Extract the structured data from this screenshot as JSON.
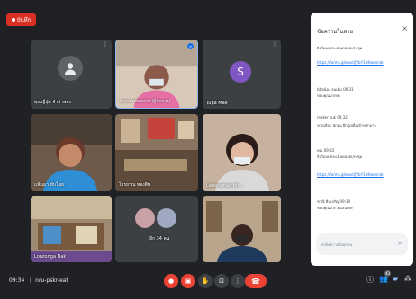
{
  "recording": {
    "label": "บันทึก"
  },
  "participants": [
    {
      "name": "คุณญี่ปุ่ม จำปาพอง",
      "avatar": ""
    },
    {
      "name": "มุกพร เสนาสาย (ผู้จัดการ)",
      "avatar": ""
    },
    {
      "name": "Tupa Mae",
      "avatar": "S"
    },
    {
      "name": "แพ้นมา ทับไชย",
      "avatar": ""
    },
    {
      "name": "ไวรยาณ ทองสิน",
      "avatar": ""
    },
    {
      "name": "Ladaramaa phi...",
      "avatar": ""
    },
    {
      "name": "Lonzonga Nak",
      "avatar": ""
    },
    {
      "name": "อีก 34 คน",
      "avatar": ""
    },
    {
      "name": "",
      "avatar": ""
    }
  ],
  "chat": {
    "title": "ข้อความในสาย",
    "close_icon": "close-icon",
    "messages": [
      {
        "text": "ลิงก์แบบประเมินหน่วยประชุม"
      },
      {
        "link": "https://forms.gle/xxUJVbY3NHomnnb"
      },
      {
        "text": "นิสิตน้อง จนเดิม 09:31"
      },
      {
        "text": "ขอบคุณมากค่ะ"
      },
      {
        "text": "rooker suk 09:32"
      },
      {
        "text": "ขาดเลือก นักอน ฝึกรู้เยนื่อเข้าหลักอาจ"
      },
      {
        "text": "คณ 09:33"
      },
      {
        "text": "ลิงก์แบบประเมินหน่วยประชุม"
      },
      {
        "link": "https://forms.gle/xxUJVbY3NHomnnb"
      },
      {
        "text": "ชาณี ยืนเจริญ 09:34"
      },
      {
        "text": "ขอบคุณมาก ดูแลนะคะ"
      }
    ],
    "input_placeholder": "ส่งข้อความถึงทุกคน"
  },
  "bottom": {
    "time": "09:34",
    "separator": "|",
    "meeting_code": "nru-pskr-eat",
    "participant_count": "43"
  },
  "colors": {
    "bg": "#202124",
    "tile": "#3c4043",
    "red": "#ea4335",
    "link": "#1a73e8"
  }
}
